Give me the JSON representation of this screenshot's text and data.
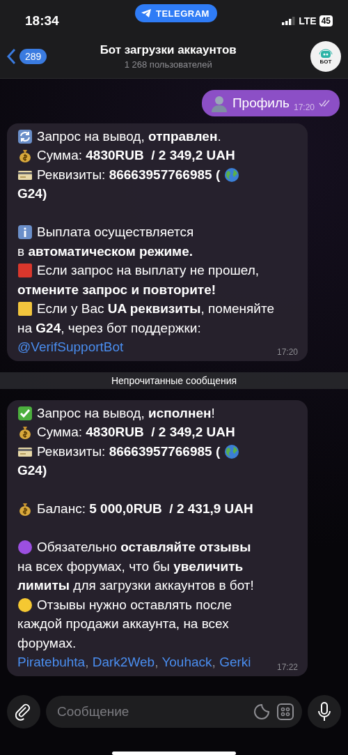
{
  "status_bar": {
    "time": "18:34",
    "app_pill": "TELEGRAM",
    "network": "LTE",
    "battery": "45"
  },
  "header": {
    "back_count": "289",
    "title": "Бот загрузки аккаунтов",
    "subtitle": "1 268 пользователей",
    "avatar_text": "БОТ"
  },
  "messages": [
    {
      "kind": "outgoing",
      "text": "Профиль",
      "time": "17:20",
      "read": true
    },
    {
      "kind": "incoming",
      "time": "17:20",
      "lines": [
        {
          "kind": "refresh",
          "text": "Запрос на вывод, **отправлен**."
        },
        {
          "kind": "moneybag",
          "text": "Сумма: **4830RUB  / 2 349,2 UAH**"
        },
        {
          "kind": "requisites",
          "text": "Реквизиты: **86663957766985 (**"
        },
        {
          "kind": "text",
          "text": "**G24)**"
        },
        {
          "kind": "gap"
        },
        {
          "kind": "info",
          "text": "Выплата осуществляется"
        },
        {
          "kind": "text",
          "text": "в **автоматическом режиме.**"
        },
        {
          "kind": "redsquare",
          "text": "Если запрос на выплату не прошел,"
        },
        {
          "kind": "text",
          "text": "**отмените запрос и повторите!**"
        },
        {
          "kind": "yellowsquare",
          "text": "Если у Вас **UA реквизиты**, поменяйте"
        },
        {
          "kind": "text",
          "text": "на **G24**, через бот поддержки:"
        },
        {
          "kind": "links",
          "links": [
            "@VerifSupportBot"
          ]
        }
      ]
    },
    {
      "kind": "divider",
      "text": "Непрочитанные сообщения"
    },
    {
      "kind": "incoming",
      "time": "17:22",
      "lines": [
        {
          "kind": "check",
          "text": "Запрос на вывод, **исполнен**!"
        },
        {
          "kind": "moneybag",
          "text": "Сумма: **4830RUB  / 2 349,2 UAH**"
        },
        {
          "kind": "requisites",
          "text": "Реквизиты: **86663957766985 (**"
        },
        {
          "kind": "text",
          "text": "**G24)**"
        },
        {
          "kind": "gap"
        },
        {
          "kind": "moneybag",
          "text": "Баланс: **5 000,0RUB  / 2 431,9 UAH**"
        },
        {
          "kind": "gap"
        },
        {
          "kind": "purplecircle",
          "text": "Обязательно **оставляйте отзывы**"
        },
        {
          "kind": "text",
          "text": "на всех форумах, что бы **увеличить**"
        },
        {
          "kind": "text",
          "text": "**лимиты** для загрузки аккаунтов в бот!"
        },
        {
          "kind": "yellowcircle",
          "text": "Отзывы нужно оставлять после"
        },
        {
          "kind": "text",
          "text": "каждой продажи аккаунта, на всех"
        },
        {
          "kind": "text",
          "text": "форумах."
        },
        {
          "kind": "links",
          "links": [
            "Piratebuhta",
            "Dark2Web",
            "Youhack",
            "Gerki"
          ],
          "separator": ","
        }
      ]
    }
  ],
  "composer": {
    "placeholder": "Сообщение"
  }
}
